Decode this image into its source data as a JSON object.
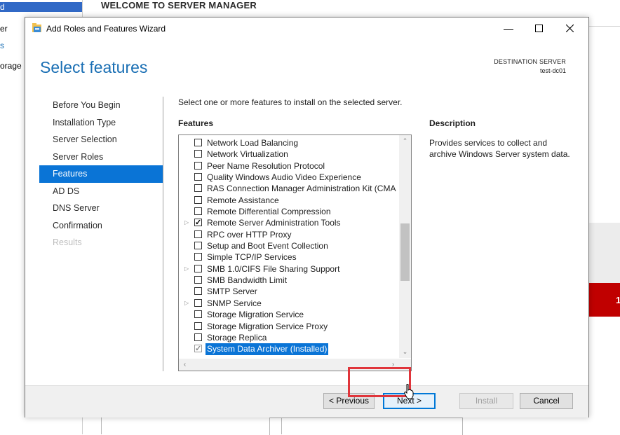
{
  "background": {
    "header_title": "WELCOME TO SERVER MANAGER",
    "sidebar_items": [
      "d",
      "er",
      "s",
      "orage"
    ],
    "alert_count": "1"
  },
  "wizard": {
    "window_title": "Add Roles and Features Wizard",
    "page_title": "Select features",
    "destination_label": "DESTINATION SERVER",
    "destination_value": "test-dc01",
    "steps": [
      {
        "label": "Before You Begin",
        "state": "normal"
      },
      {
        "label": "Installation Type",
        "state": "normal"
      },
      {
        "label": "Server Selection",
        "state": "normal"
      },
      {
        "label": "Server Roles",
        "state": "normal"
      },
      {
        "label": "Features",
        "state": "active"
      },
      {
        "label": "AD DS",
        "state": "normal"
      },
      {
        "label": "DNS Server",
        "state": "normal"
      },
      {
        "label": "Confirmation",
        "state": "normal"
      },
      {
        "label": "Results",
        "state": "disabled"
      }
    ],
    "instruction": "Select one or more features to install on the selected server.",
    "features_header": "Features",
    "description_header": "Description",
    "description_text": "Provides services to collect and archive Windows Server system data.",
    "features": [
      {
        "label": "Network Load Balancing",
        "checked": false,
        "expandable": false
      },
      {
        "label": "Network Virtualization",
        "checked": false,
        "expandable": false
      },
      {
        "label": "Peer Name Resolution Protocol",
        "checked": false,
        "expandable": false
      },
      {
        "label": "Quality Windows Audio Video Experience",
        "checked": false,
        "expandable": false
      },
      {
        "label": "RAS Connection Manager Administration Kit (CMA",
        "checked": false,
        "expandable": false
      },
      {
        "label": "Remote Assistance",
        "checked": false,
        "expandable": false
      },
      {
        "label": "Remote Differential Compression",
        "checked": false,
        "expandable": false
      },
      {
        "label": "Remote Server Administration Tools",
        "checked": true,
        "expandable": true
      },
      {
        "label": "RPC over HTTP Proxy",
        "checked": false,
        "expandable": false
      },
      {
        "label": "Setup and Boot Event Collection",
        "checked": false,
        "expandable": false
      },
      {
        "label": "Simple TCP/IP Services",
        "checked": false,
        "expandable": false
      },
      {
        "label": "SMB 1.0/CIFS File Sharing Support",
        "checked": false,
        "expandable": true
      },
      {
        "label": "SMB Bandwidth Limit",
        "checked": false,
        "expandable": false
      },
      {
        "label": "SMTP Server",
        "checked": false,
        "expandable": false
      },
      {
        "label": "SNMP Service",
        "checked": false,
        "expandable": true
      },
      {
        "label": "Storage Migration Service",
        "checked": false,
        "expandable": false
      },
      {
        "label": "Storage Migration Service Proxy",
        "checked": false,
        "expandable": false
      },
      {
        "label": "Storage Replica",
        "checked": false,
        "expandable": false
      },
      {
        "label": "System Data Archiver (Installed)",
        "checked": true,
        "expandable": false,
        "selected": true,
        "installed": true
      }
    ],
    "buttons": {
      "previous": "< Previous",
      "next": "Next >",
      "install": "Install",
      "cancel": "Cancel"
    },
    "colors": {
      "accent": "#0a74d6",
      "title": "#1a6fb4",
      "highlight": "#e0353b"
    }
  }
}
